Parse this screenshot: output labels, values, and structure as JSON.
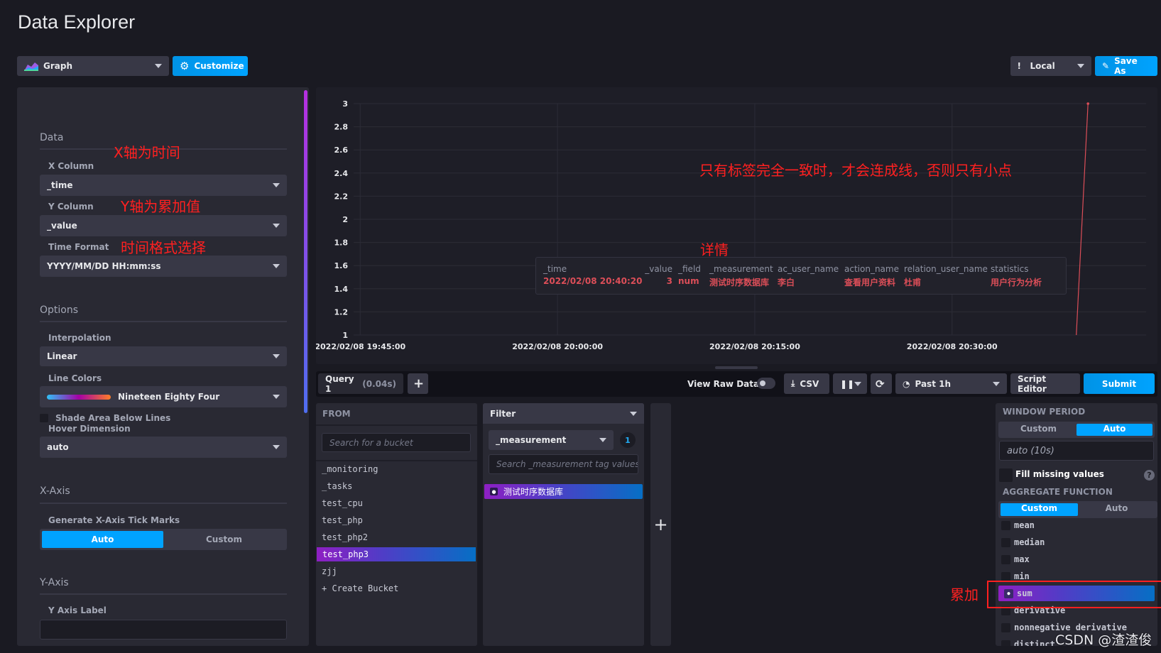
{
  "page": {
    "title": "Data Explorer"
  },
  "toolbar": {
    "view_type": "Graph",
    "customize": "Customize",
    "timezone": "Local",
    "save_as": "Save As"
  },
  "customize": {
    "data_heading": "Data",
    "x_column_label": "X Column",
    "x_column": "_time",
    "y_column_label": "Y Column",
    "y_column": "_value",
    "time_format_label": "Time Format",
    "time_format": "YYYY/MM/DD HH:mm:ss",
    "options_heading": "Options",
    "interpolation_label": "Interpolation",
    "interpolation": "Linear",
    "line_colors_label": "Line Colors",
    "line_colors": "Nineteen Eighty Four",
    "shade_label": "Shade Area Below Lines",
    "shade_checked": false,
    "hover_label": "Hover Dimension",
    "hover": "auto",
    "xaxis_heading": "X-Axis",
    "tick_marks_label": "Generate X-Axis Tick Marks",
    "tick_auto": "Auto",
    "tick_custom": "Custom",
    "tick_selected": "Auto",
    "yaxis_heading": "Y-Axis",
    "y_axis_label_label": "Y Axis Label",
    "y_axis_label_value": ""
  },
  "annotations": {
    "x_axis": "X轴为时间",
    "y_axis": "Y轴为累加值",
    "time_format": "时间格式选择",
    "line_note": "只有标签完全一致时，才会连成线，否则只有小点",
    "detail": "详情",
    "sum": "累加"
  },
  "chart_data": {
    "type": "line",
    "title": "",
    "xlabel": "",
    "ylabel": "",
    "ylim": [
      1,
      3
    ],
    "y_ticks": [
      "1",
      "1.2",
      "1.4",
      "1.6",
      "1.8",
      "2",
      "2.2",
      "2.4",
      "2.6",
      "2.8",
      "3"
    ],
    "xlim": [
      "2022/02/08 19:44:30",
      "2022/02/08 20:44:45"
    ],
    "x_ticks": [
      "2022/02/08 19:45:00",
      "2022/02/08 20:00:00",
      "2022/02/08 20:15:00",
      "2022/02/08 20:30:00"
    ],
    "grid": true,
    "line_color": "#dc4e58",
    "series": [
      {
        "points": [
          [
            "2022/02/08 20:39:00",
            0
          ],
          [
            "2022/02/08 20:40:20",
            3
          ]
        ]
      }
    ]
  },
  "tooltip": {
    "headers": [
      "_time",
      "_value",
      "_field",
      "_measurement",
      "ac_user_name",
      "action_name",
      "relation_user_name",
      "statistics"
    ],
    "values": [
      "2022/02/08 20:40:20",
      "3",
      "num",
      "测试时序数据库",
      "李白",
      "查看用户资料",
      "杜甫",
      "用户行为分析"
    ]
  },
  "query": {
    "tab": "Query 1",
    "timing": "(0.04s)",
    "view_raw": "View Raw Data",
    "csv": "CSV",
    "range": "Past 1h",
    "script_editor": "Script Editor",
    "submit": "Submit"
  },
  "from": {
    "heading": "FROM",
    "search_placeholder": "Search for a bucket",
    "buckets": [
      "_monitoring",
      "_tasks",
      "test_cpu",
      "test_php",
      "test_php2",
      "test_php3",
      "zjj"
    ],
    "selected": "test_php3",
    "create": "+ Create Bucket"
  },
  "filter": {
    "heading": "Filter",
    "key": "_measurement",
    "count": "1",
    "search_placeholder": "Search _measurement tag values",
    "values": [
      "测试时序数据库"
    ]
  },
  "window": {
    "heading": "WINDOW PERIOD",
    "custom": "Custom",
    "auto": "Auto",
    "selected": "Auto",
    "value": "auto (10s)",
    "fill_missing": "Fill missing values",
    "agg_heading": "AGGREGATE FUNCTION",
    "agg_selected_mode": "Custom",
    "functions": [
      "mean",
      "median",
      "max",
      "min",
      "sum",
      "derivative",
      "nonnegative derivative",
      "distinct"
    ],
    "selected_function": "sum"
  },
  "watermark": "CSDN @渣渣俊"
}
